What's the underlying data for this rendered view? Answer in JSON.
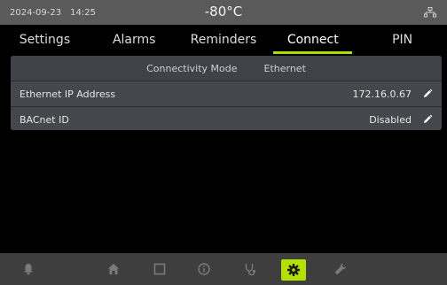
{
  "status": {
    "date": "2024-09-23",
    "time": "14:25",
    "temperature": "-80°C",
    "network_icon": "network-icon"
  },
  "tabs": [
    {
      "label": "Settings",
      "active": false
    },
    {
      "label": "Alarms",
      "active": false
    },
    {
      "label": "Reminders",
      "active": false
    },
    {
      "label": "Connect",
      "active": true
    },
    {
      "label": "PIN",
      "active": false
    }
  ],
  "connect": {
    "mode_label": "Connectivity Mode",
    "mode_value": "Ethernet",
    "rows": [
      {
        "label": "Ethernet IP Address",
        "value": "172.16.0.67"
      },
      {
        "label": "BACnet ID",
        "value": "Disabled"
      }
    ]
  },
  "bottom_nav": [
    {
      "icon": "bell-icon",
      "active": false
    },
    {
      "icon": "home-icon",
      "active": false
    },
    {
      "icon": "grid-icon",
      "active": false
    },
    {
      "icon": "info-icon",
      "active": false
    },
    {
      "icon": "stethoscope-icon",
      "active": false
    },
    {
      "icon": "gear-icon",
      "active": true
    },
    {
      "icon": "wrench-icon",
      "active": false
    }
  ],
  "colors": {
    "accent": "#b2e000",
    "statusbar": "#5a5a5a",
    "panel": "#3a3c40",
    "nav": "#3e3e3e"
  }
}
